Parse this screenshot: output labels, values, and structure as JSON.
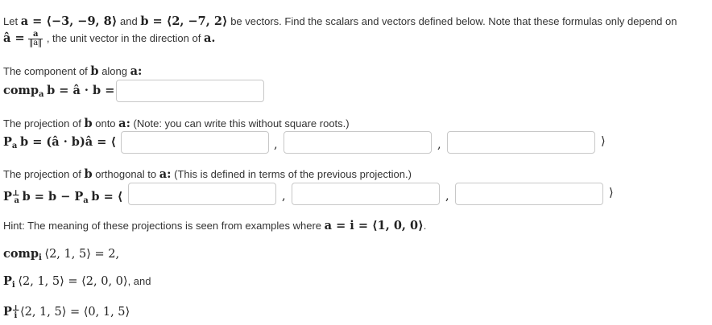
{
  "intro": {
    "let": "Let",
    "a_def": "a = ⟨−3, −9, 8⟩",
    "and": "and",
    "b_def": "b = ⟨2, −7, 2⟩",
    "text1": "be vectors. Find the scalars and vectors defined below. Note that these formulas only depend on",
    "ahat_lhs": "â =",
    "frac_num": "a",
    "frac_den": "‖a‖",
    "text2": ", the unit vector in the direction of",
    "a_end": "a."
  },
  "q1": {
    "label_pre": "The component of",
    "b": "b",
    "label_mid": "along",
    "a": "a:",
    "formula_comp": "comp",
    "formula_sub": "a",
    "formula_rest": "b = â · b =",
    "answer": ""
  },
  "q2": {
    "label_pre": "The projection of",
    "b": "b",
    "label_mid": "onto",
    "a": "a:",
    "note": "(Note: you can write this without square roots.)",
    "formula_P": "P",
    "formula_sub": "a",
    "formula_rest": "b = (â · b)â = ⟨",
    "answers": [
      "",
      "",
      ""
    ],
    "comma": ",",
    "close": "⟩"
  },
  "q3": {
    "label_pre": "The projection of",
    "b": "b",
    "label_mid": "orthogonal to",
    "a": "a:",
    "note": "(This is defined in terms of the previous projection.)",
    "formula_P": "P",
    "formula_sup": "⊥",
    "formula_sub": "a",
    "formula_rest": "b = b − P",
    "formula_sub2": "a",
    "formula_rest2": "b = ⟨",
    "answers": [
      "",
      "",
      ""
    ],
    "comma": ",",
    "close": "⟩"
  },
  "hint": {
    "text": "Hint: The meaning of these projections is seen from examples where",
    "math": "a = i = ⟨1, 0, 0⟩",
    "end": ".",
    "ex1_comp": "comp",
    "ex1_sub": "i",
    "ex1_rest": "⟨2, 1, 5⟩ = 2,",
    "ex2_P": "P",
    "ex2_sub": "i",
    "ex2_rest": "⟨2, 1, 5⟩ = ⟨2, 0, 0⟩",
    "ex2_and": ", and",
    "ex3_P": "P",
    "ex3_sup": "⊥",
    "ex3_sub": "i",
    "ex3_rest": "⟨2, 1, 5⟩ = ⟨0, 1, 5⟩"
  }
}
